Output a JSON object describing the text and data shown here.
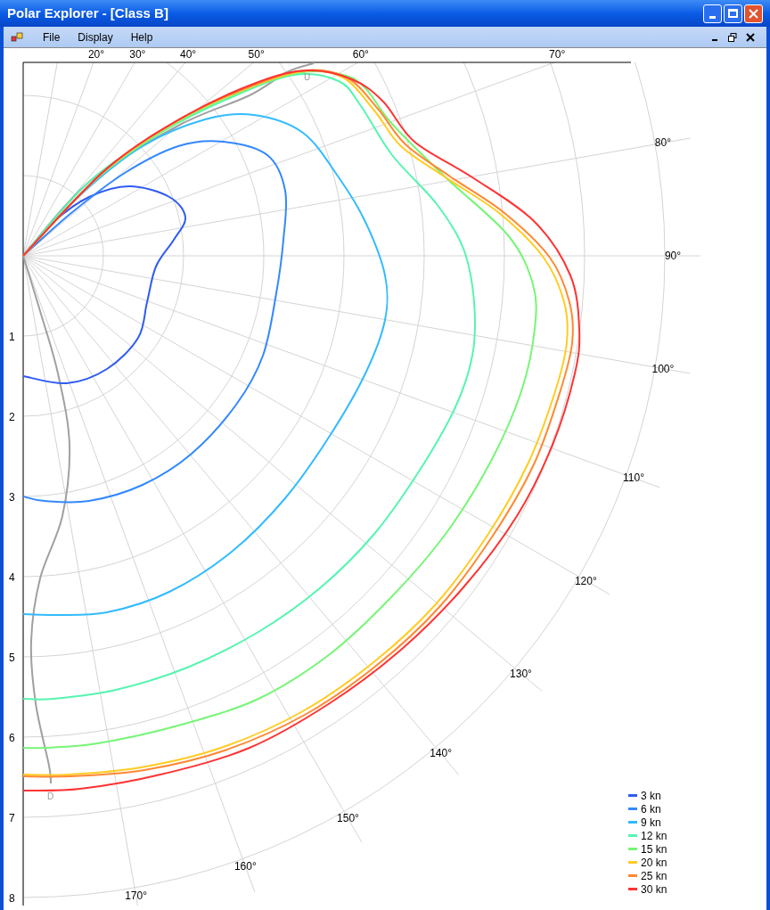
{
  "window": {
    "title": "Polar Explorer - [Class B]"
  },
  "menu": [
    "File",
    "Display",
    "Help"
  ],
  "chart": {
    "angle_labels": [
      "20°",
      "30°",
      "40°",
      "50°",
      "60°",
      "70°",
      "80°",
      "90°",
      "100°",
      "110°",
      "120°",
      "130°",
      "140°",
      "150°",
      "160°",
      "170°"
    ],
    "speed_labels": [
      "1",
      "2",
      "3",
      "4",
      "5",
      "6",
      "7",
      "8"
    ],
    "markers": {
      "upwind": "U",
      "downwind": "D"
    },
    "legend": [
      {
        "label": "3 kn",
        "color": "#2f5bf2"
      },
      {
        "label": "6 kn",
        "color": "#3388ff"
      },
      {
        "label": "9 kn",
        "color": "#33bbff"
      },
      {
        "label": "12 kn",
        "color": "#55f5b0"
      },
      {
        "label": "15 kn",
        "color": "#77f577"
      },
      {
        "label": "20 kn",
        "color": "#ffcc22"
      },
      {
        "label": "25 kn",
        "color": "#ff8833"
      },
      {
        "label": "30 kn",
        "color": "#ff3333"
      }
    ]
  }
}
